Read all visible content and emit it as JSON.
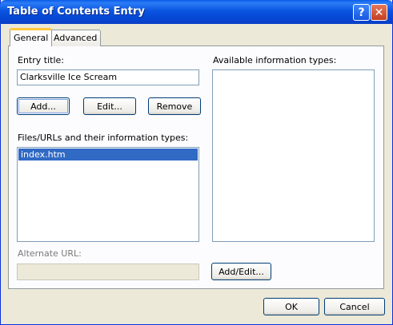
{
  "window": {
    "title": "Table of Contents Entry",
    "help_glyph": "?",
    "close_glyph": "✕"
  },
  "tabs": [
    {
      "label": "General",
      "active": true
    },
    {
      "label": "Advanced",
      "active": false
    }
  ],
  "general": {
    "entry_title_label": "Entry title:",
    "entry_title_value": "Clarksville Ice Scream",
    "add_label": "Add...",
    "edit_label": "Edit...",
    "remove_label": "Remove",
    "files_label": "Files/URLs and their information types:",
    "files": [
      "index.htm"
    ],
    "alternate_url_label": "Alternate URL:",
    "alternate_url_value": "",
    "info_types_label": "Available information types:",
    "add_edit_label": "Add/Edit..."
  },
  "footer": {
    "ok_label": "OK",
    "cancel_label": "Cancel"
  },
  "colors": {
    "titlebar": "#0a55e0",
    "selection": "#316ac5",
    "dialog_bg": "#ece9d8"
  }
}
